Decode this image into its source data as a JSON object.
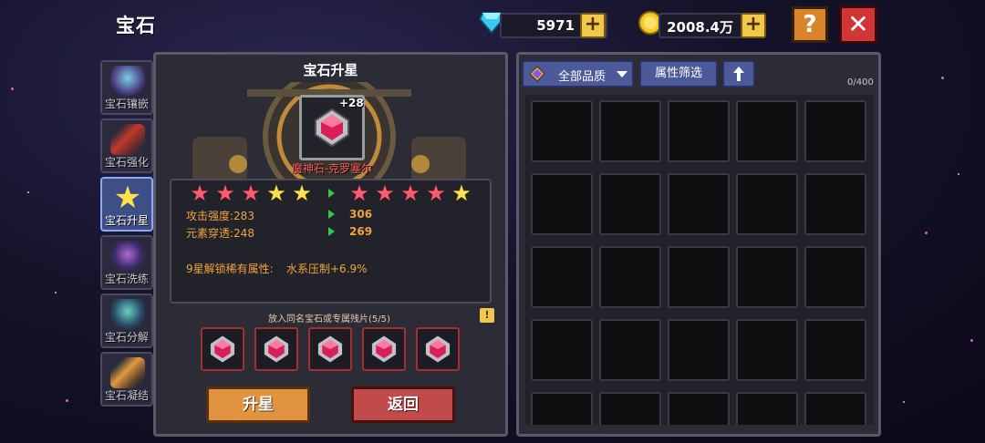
{
  "header": {
    "title": "宝石",
    "diamonds": "5971",
    "gold": "2008.4万",
    "help_label": "?",
    "close_label": "✕",
    "plus_label": "+"
  },
  "sidebar": {
    "items": [
      {
        "label": "宝石镶嵌",
        "icon": "gem-inlay-icon",
        "active": false
      },
      {
        "label": "宝石强化",
        "icon": "gem-enhance-icon",
        "active": false
      },
      {
        "label": "宝石升星",
        "icon": "gem-star-up-icon",
        "active": true
      },
      {
        "label": "宝石洗练",
        "icon": "gem-refine-icon",
        "active": false
      },
      {
        "label": "宝石分解",
        "icon": "gem-decompose-icon",
        "active": false
      },
      {
        "label": "宝石凝结",
        "icon": "gem-condense-icon",
        "active": false
      }
    ]
  },
  "upgrade_panel": {
    "title": "宝石升星",
    "gem_level": "+28",
    "gem_name": "魔神石-克罗塞尔",
    "current_stars": {
      "red": 3,
      "gold": 2
    },
    "next_stars": {
      "red": 4,
      "gold": 1
    },
    "stats": [
      {
        "label": "攻击强度:283",
        "next": "306"
      },
      {
        "label": "元素穿透:248",
        "next": "269"
      }
    ],
    "rare_unlock_label": "9星解锁稀有属性:",
    "rare_unlock_value": "水系压制+6.9%",
    "material_hint": "放入同名宝石或专属残片(5/5)",
    "hint_badge": "!",
    "material_slots": 5,
    "upgrade_button": "升星",
    "back_button": "返回"
  },
  "inventory": {
    "quality_filter": "全部品质",
    "attribute_filter": "属性筛选",
    "sort_icon": "up-arrow-icon",
    "count": "0/400"
  },
  "colors": {
    "accent_orange": "#f2a43a",
    "button_orange": "#e19340",
    "button_red": "#c14a4a",
    "filter_blue": "#4d5a9a",
    "arrow_green": "#34c84a"
  }
}
